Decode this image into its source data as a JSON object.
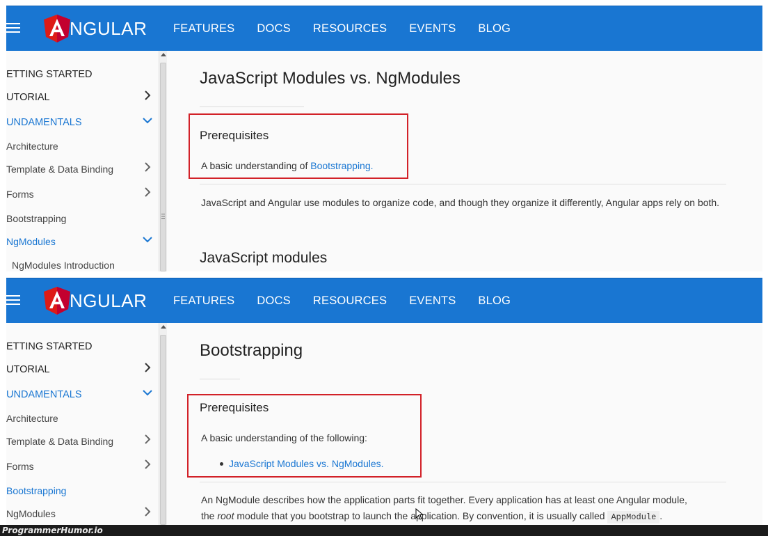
{
  "header": {
    "logo_text": "NGULAR",
    "nav": [
      "FEATURES",
      "DOCS",
      "RESOURCES",
      "EVENTS",
      "BLOG"
    ]
  },
  "sidebar_top": {
    "items": [
      {
        "label": "ETTING STARTED",
        "chevron": "none"
      },
      {
        "label": "UTORIAL",
        "chevron": "right"
      },
      {
        "label": "UNDAMENTALS",
        "chevron": "down"
      },
      {
        "label": "Architecture",
        "chevron": "none"
      },
      {
        "label": "Template & Data Binding",
        "chevron": "right"
      },
      {
        "label": "Forms",
        "chevron": "right"
      },
      {
        "label": "Bootstrapping",
        "chevron": "none"
      },
      {
        "label": "NgModules",
        "chevron": "down"
      },
      {
        "label": "NgModules Introduction",
        "chevron": "none"
      }
    ]
  },
  "sidebar_bottom": {
    "items": [
      {
        "label": "ETTING STARTED",
        "chevron": "none"
      },
      {
        "label": "UTORIAL",
        "chevron": "right"
      },
      {
        "label": "UNDAMENTALS",
        "chevron": "down"
      },
      {
        "label": "Architecture",
        "chevron": "none"
      },
      {
        "label": "Template & Data Binding",
        "chevron": "right"
      },
      {
        "label": "Forms",
        "chevron": "right"
      },
      {
        "label": "Bootstrapping",
        "chevron": "none"
      },
      {
        "label": "NgModules",
        "chevron": "right"
      }
    ]
  },
  "top_page": {
    "title": "JavaScript Modules vs. NgModules",
    "prereq_heading": "Prerequisites",
    "prereq_text": "A basic understanding of ",
    "prereq_link": "Bootstrapping.",
    "body": "JavaScript and Angular use modules to organize code, and though they organize it differently, Angular apps rely on both.",
    "section_heading": "JavaScript modules"
  },
  "bottom_page": {
    "title": "Bootstrapping",
    "prereq_heading": "Prerequisites",
    "prereq_text": "A basic understanding of the following:",
    "prereq_link": "JavaScript Modules vs. NgModules.",
    "body_1": "An NgModule describes how the application parts fit together. Every application has at least one Angular module,",
    "body_2a": "the ",
    "body_2_em": "root",
    "body_2b": " module that you bootstrap to launch the application. By convention, it is usually called ",
    "body_2_code": "AppModule",
    "body_2c": "."
  },
  "footer": {
    "watermark": "ProgrammerHumor.io"
  },
  "colors": {
    "brand": "#1976d2",
    "highlight": "#d22128"
  }
}
